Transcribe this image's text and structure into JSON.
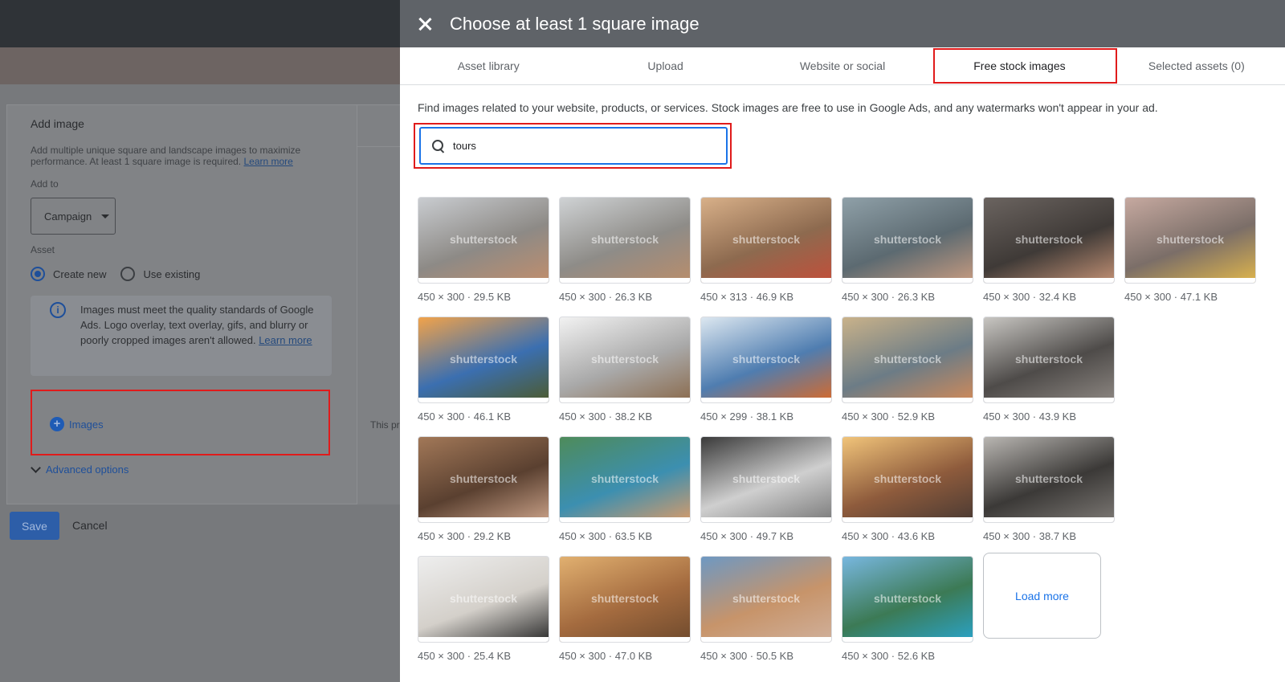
{
  "background": {
    "card_title": "Add image",
    "description": "Add multiple unique square and landscape images to maximize performance. At least 1 square image is required.",
    "learn_more": "Learn more",
    "add_to_label": "Add to",
    "add_to_value": "Campaign",
    "asset_label": "Asset",
    "radio_create": "Create new",
    "radio_existing": "Use existing",
    "info_text": "Images must meet the quality standards of Google Ads. Logo overlay, text overlay, gifs, and blurry or poorly cropped images aren't allowed.",
    "info_link": "Learn more",
    "images_button": "Images",
    "advanced": "Advanced options",
    "save": "Save",
    "cancel": "Cancel",
    "side_hint": "This pr make s certain"
  },
  "dialog": {
    "title": "Choose at least 1 square image",
    "tabs": [
      {
        "label": "Asset library"
      },
      {
        "label": "Upload"
      },
      {
        "label": "Website or social"
      },
      {
        "label": "Free stock images"
      },
      {
        "label": "Selected assets (0)"
      }
    ],
    "active_tab": "Free stock images",
    "intro": "Find images related to your website, products, or services. Stock images are free to use in Google Ads, and any watermarks won't appear in your ad.",
    "search_value": "tours",
    "watermark": "shutterstock",
    "images": [
      {
        "caption": "450 × 300 · 29.5 KB",
        "colors": [
          "#c9ccd0",
          "#8d8a86",
          "#c08e6d"
        ]
      },
      {
        "caption": "450 × 300 · 26.3 KB",
        "colors": [
          "#cfd2d4",
          "#8e8c88",
          "#b98d6b"
        ]
      },
      {
        "caption": "450 × 313 · 46.9 KB",
        "colors": [
          "#d8b089",
          "#8d6a4f",
          "#c24f3a"
        ]
      },
      {
        "caption": "450 × 300 · 26.3 KB",
        "colors": [
          "#8fa0a8",
          "#5c6a71",
          "#c79b80"
        ]
      },
      {
        "caption": "450 × 300 · 32.4 KB",
        "colors": [
          "#6b6460",
          "#3f3a37",
          "#c29074"
        ]
      },
      {
        "caption": "450 × 300 · 47.1 KB",
        "colors": [
          "#c6a9a0",
          "#7b6e68",
          "#e0b64c"
        ]
      },
      {
        "caption": "450 × 300 · 46.1 KB",
        "colors": [
          "#f2a34a",
          "#3b6fb0",
          "#4d5a2c"
        ]
      },
      {
        "caption": "450 × 300 · 38.2 KB",
        "colors": [
          "#f2f2f2",
          "#a9a9a9",
          "#8a6a4c"
        ]
      },
      {
        "caption": "450 × 299 · 38.1 KB",
        "colors": [
          "#dce7f0",
          "#4f7db0",
          "#d86a2a"
        ]
      },
      {
        "caption": "450 × 300 · 52.9 KB",
        "colors": [
          "#c9b28a",
          "#6c7c86",
          "#d18a59"
        ]
      },
      {
        "caption": "450 × 300 · 43.9 KB",
        "colors": [
          "#c8c6c2",
          "#4e4b49",
          "#8d8782"
        ]
      },
      {
        "caption": "450 × 300 · 29.2 KB",
        "colors": [
          "#a27858",
          "#5a4030",
          "#c9a188"
        ]
      },
      {
        "caption": "450 × 300 · 63.5 KB",
        "colors": [
          "#4e8b5a",
          "#3c8fb0",
          "#d79b6a"
        ]
      },
      {
        "caption": "450 × 300 · 49.7 KB",
        "colors": [
          "#3a3a3a",
          "#cfcfcf",
          "#7a7a7a"
        ]
      },
      {
        "caption": "450 × 300 · 43.6 KB",
        "colors": [
          "#f1c47a",
          "#8e5b3c",
          "#4a3a33"
        ]
      },
      {
        "caption": "450 × 300 · 38.7 KB",
        "colors": [
          "#b9b6b2",
          "#3b3937",
          "#7c7874"
        ]
      },
      {
        "caption": "450 × 300 · 25.4 KB",
        "colors": [
          "#eeeeee",
          "#d4d0ca",
          "#2b2b2b"
        ]
      },
      {
        "caption": "450 × 300 · 47.0 KB",
        "colors": [
          "#e1b070",
          "#a46b3f",
          "#6f4a2d"
        ]
      },
      {
        "caption": "450 × 300 · 50.5 KB",
        "colors": [
          "#6e98c2",
          "#c7946a",
          "#d0b09b"
        ]
      },
      {
        "caption": "450 × 300 · 52.6 KB",
        "colors": [
          "#78b7df",
          "#3c7a55",
          "#2aa3c8"
        ]
      }
    ],
    "load_more": "Load more"
  }
}
